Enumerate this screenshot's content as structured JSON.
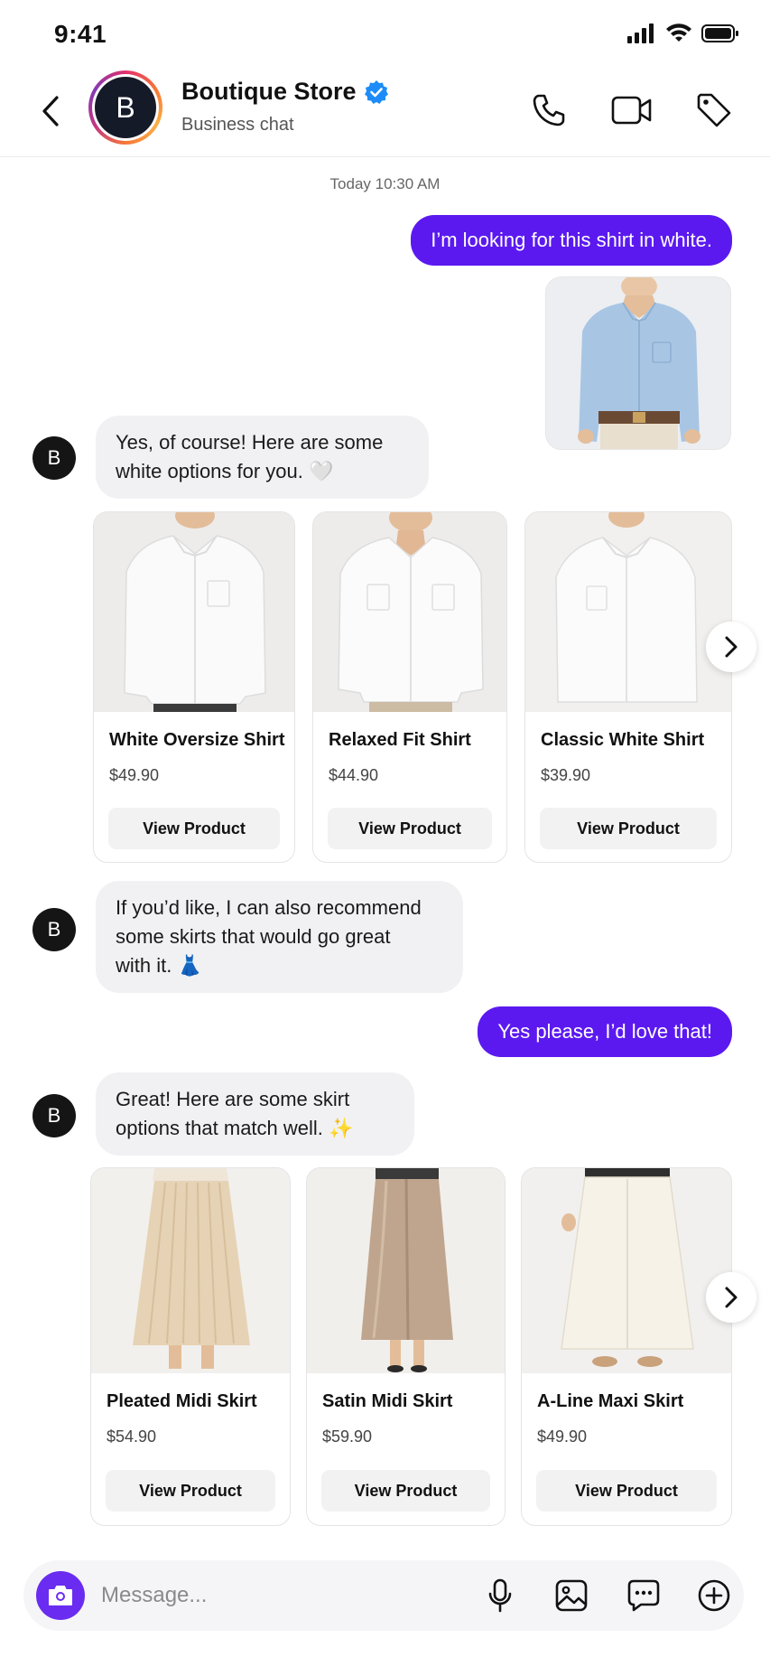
{
  "status_bar": {
    "time": "9:41"
  },
  "header": {
    "avatar_initial": "B",
    "store_name": "Boutique Store",
    "subtitle": "Business chat",
    "icons": [
      "back-chevron-icon",
      "phone-icon",
      "video-camera-icon",
      "tag-icon",
      "verified-badge-icon"
    ]
  },
  "chat": {
    "timestamp": "Today 10:30 AM",
    "messages": [
      {
        "from": "user",
        "text": "I’m looking for this shirt in white."
      },
      {
        "from": "bot",
        "avatar": "B",
        "line1": "Yes, of course! Here are some",
        "line2": "white options for you. 🤍"
      },
      {
        "from": "bot",
        "avatar": "B",
        "line1": "If you’d like, I can also recommend",
        "line2": "some skirts that would go great",
        "line3": "with it. 👗"
      },
      {
        "from": "user",
        "text": "Yes please, I’d love that!"
      },
      {
        "from": "bot",
        "avatar": "B",
        "line1": "Great! Here are some skirt",
        "line2": "options that match well. ✨"
      }
    ],
    "shirts": [
      {
        "title": "White Oversize Shirt",
        "price": "$49.90",
        "button": "View Product"
      },
      {
        "title": "Relaxed Fit Shirt",
        "price": "$44.90",
        "button": "View Product"
      },
      {
        "title": "Classic White Shirt",
        "price": "$39.90",
        "button": "View Product"
      }
    ],
    "skirts": [
      {
        "title": "Pleated Midi Skirt",
        "price": "$54.90",
        "button": "View Product"
      },
      {
        "title": "Satin Midi Skirt",
        "price": "$59.90",
        "button": "View Product"
      },
      {
        "title": "A-Line Maxi Skirt",
        "price": "$49.90",
        "button": "View Product"
      }
    ]
  },
  "composer": {
    "placeholder": "Message...",
    "icons": [
      "camera-icon",
      "microphone-icon",
      "image-icon",
      "chat-dots-icon",
      "plus-circle-icon"
    ]
  },
  "colors": {
    "accent": "#5b19f0",
    "incoming_bubble": "#f1f1f3",
    "verified": "#1d8cf8"
  }
}
